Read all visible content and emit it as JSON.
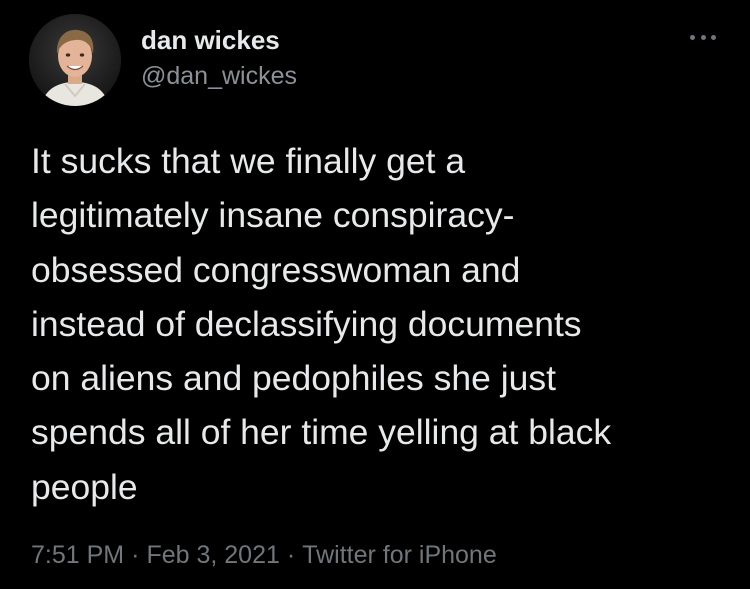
{
  "author": {
    "name": "dan wickes",
    "handle": "@dan_wickes"
  },
  "tweet": {
    "text_lines": [
      "It sucks that we finally get a",
      "legitimately insane conspiracy-",
      "obsessed congresswoman and",
      "instead of declassifying documents",
      "on aliens and pedophiles she just",
      "spends all of her time yelling at black",
      "people"
    ],
    "time": "7:51 PM",
    "date": "Feb 3, 2021",
    "source": "Twitter for iPhone",
    "separator": "·"
  },
  "icons": {
    "more": "more-options-icon",
    "avatar": "avatar"
  },
  "colors": {
    "background": "#000000",
    "text": "#e7e9ea",
    "secondary_text": "#71767b"
  }
}
